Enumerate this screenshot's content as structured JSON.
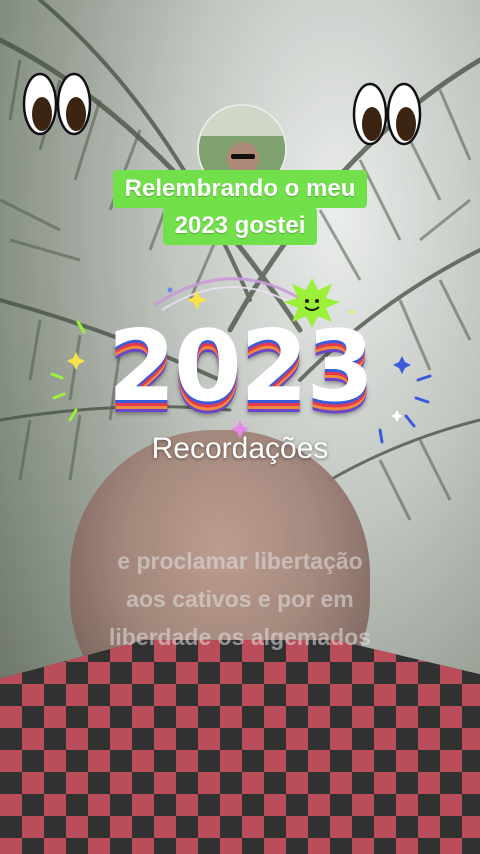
{
  "caption": {
    "line1": "Relembrando o meu",
    "line2": "2023 gostei"
  },
  "sticker": {
    "year": "2023",
    "subtitle": "Recordações"
  },
  "quote": {
    "line1": "e proclamar libertação",
    "line2": "aos cativos e por em",
    "line3": "liberdade os algemados"
  },
  "colors": {
    "caption_bg": "#72e04a",
    "year_stripe_blue": "#3b5bdb",
    "year_stripe_red": "#e53950",
    "year_stripe_orange": "#f08a3c",
    "sun_sticker": "#9cf03a"
  },
  "icons": [
    "eyes-emoji-icon",
    "eyes-emoji-icon",
    "sun-sticker-icon",
    "sparkle-icon"
  ]
}
